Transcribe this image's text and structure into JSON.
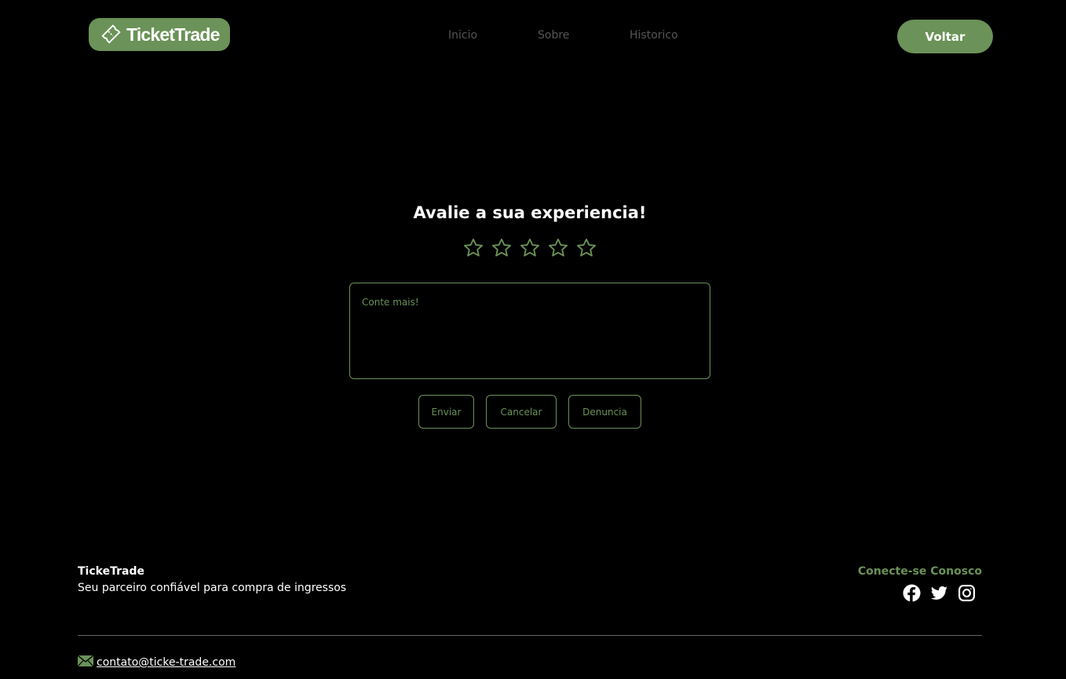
{
  "header": {
    "logo_text": "TicketTrade",
    "nav": [
      "Inicio",
      "Sobre",
      "Historico"
    ],
    "back_label": "Voltar"
  },
  "review": {
    "title": "Avalie a sua experiencia!",
    "rating": {
      "selected": 0,
      "max": 5
    },
    "comment_placeholder": "Conte mais!",
    "buttons": {
      "send": "Enviar",
      "cancel": "Cancelar",
      "report": "Denuncia"
    }
  },
  "footer": {
    "brand": "TickeTrade",
    "tagline": "Seu parceiro confiável para compra de ingressos",
    "connect_label": "Conecte-se Conosco",
    "socials": [
      "facebook-icon",
      "twitter-icon",
      "instagram-icon"
    ],
    "email": "contato@ticke-trade.com"
  },
  "colors": {
    "accent": "#6b9258",
    "background": "#000000",
    "muted_nav": "#555555"
  }
}
